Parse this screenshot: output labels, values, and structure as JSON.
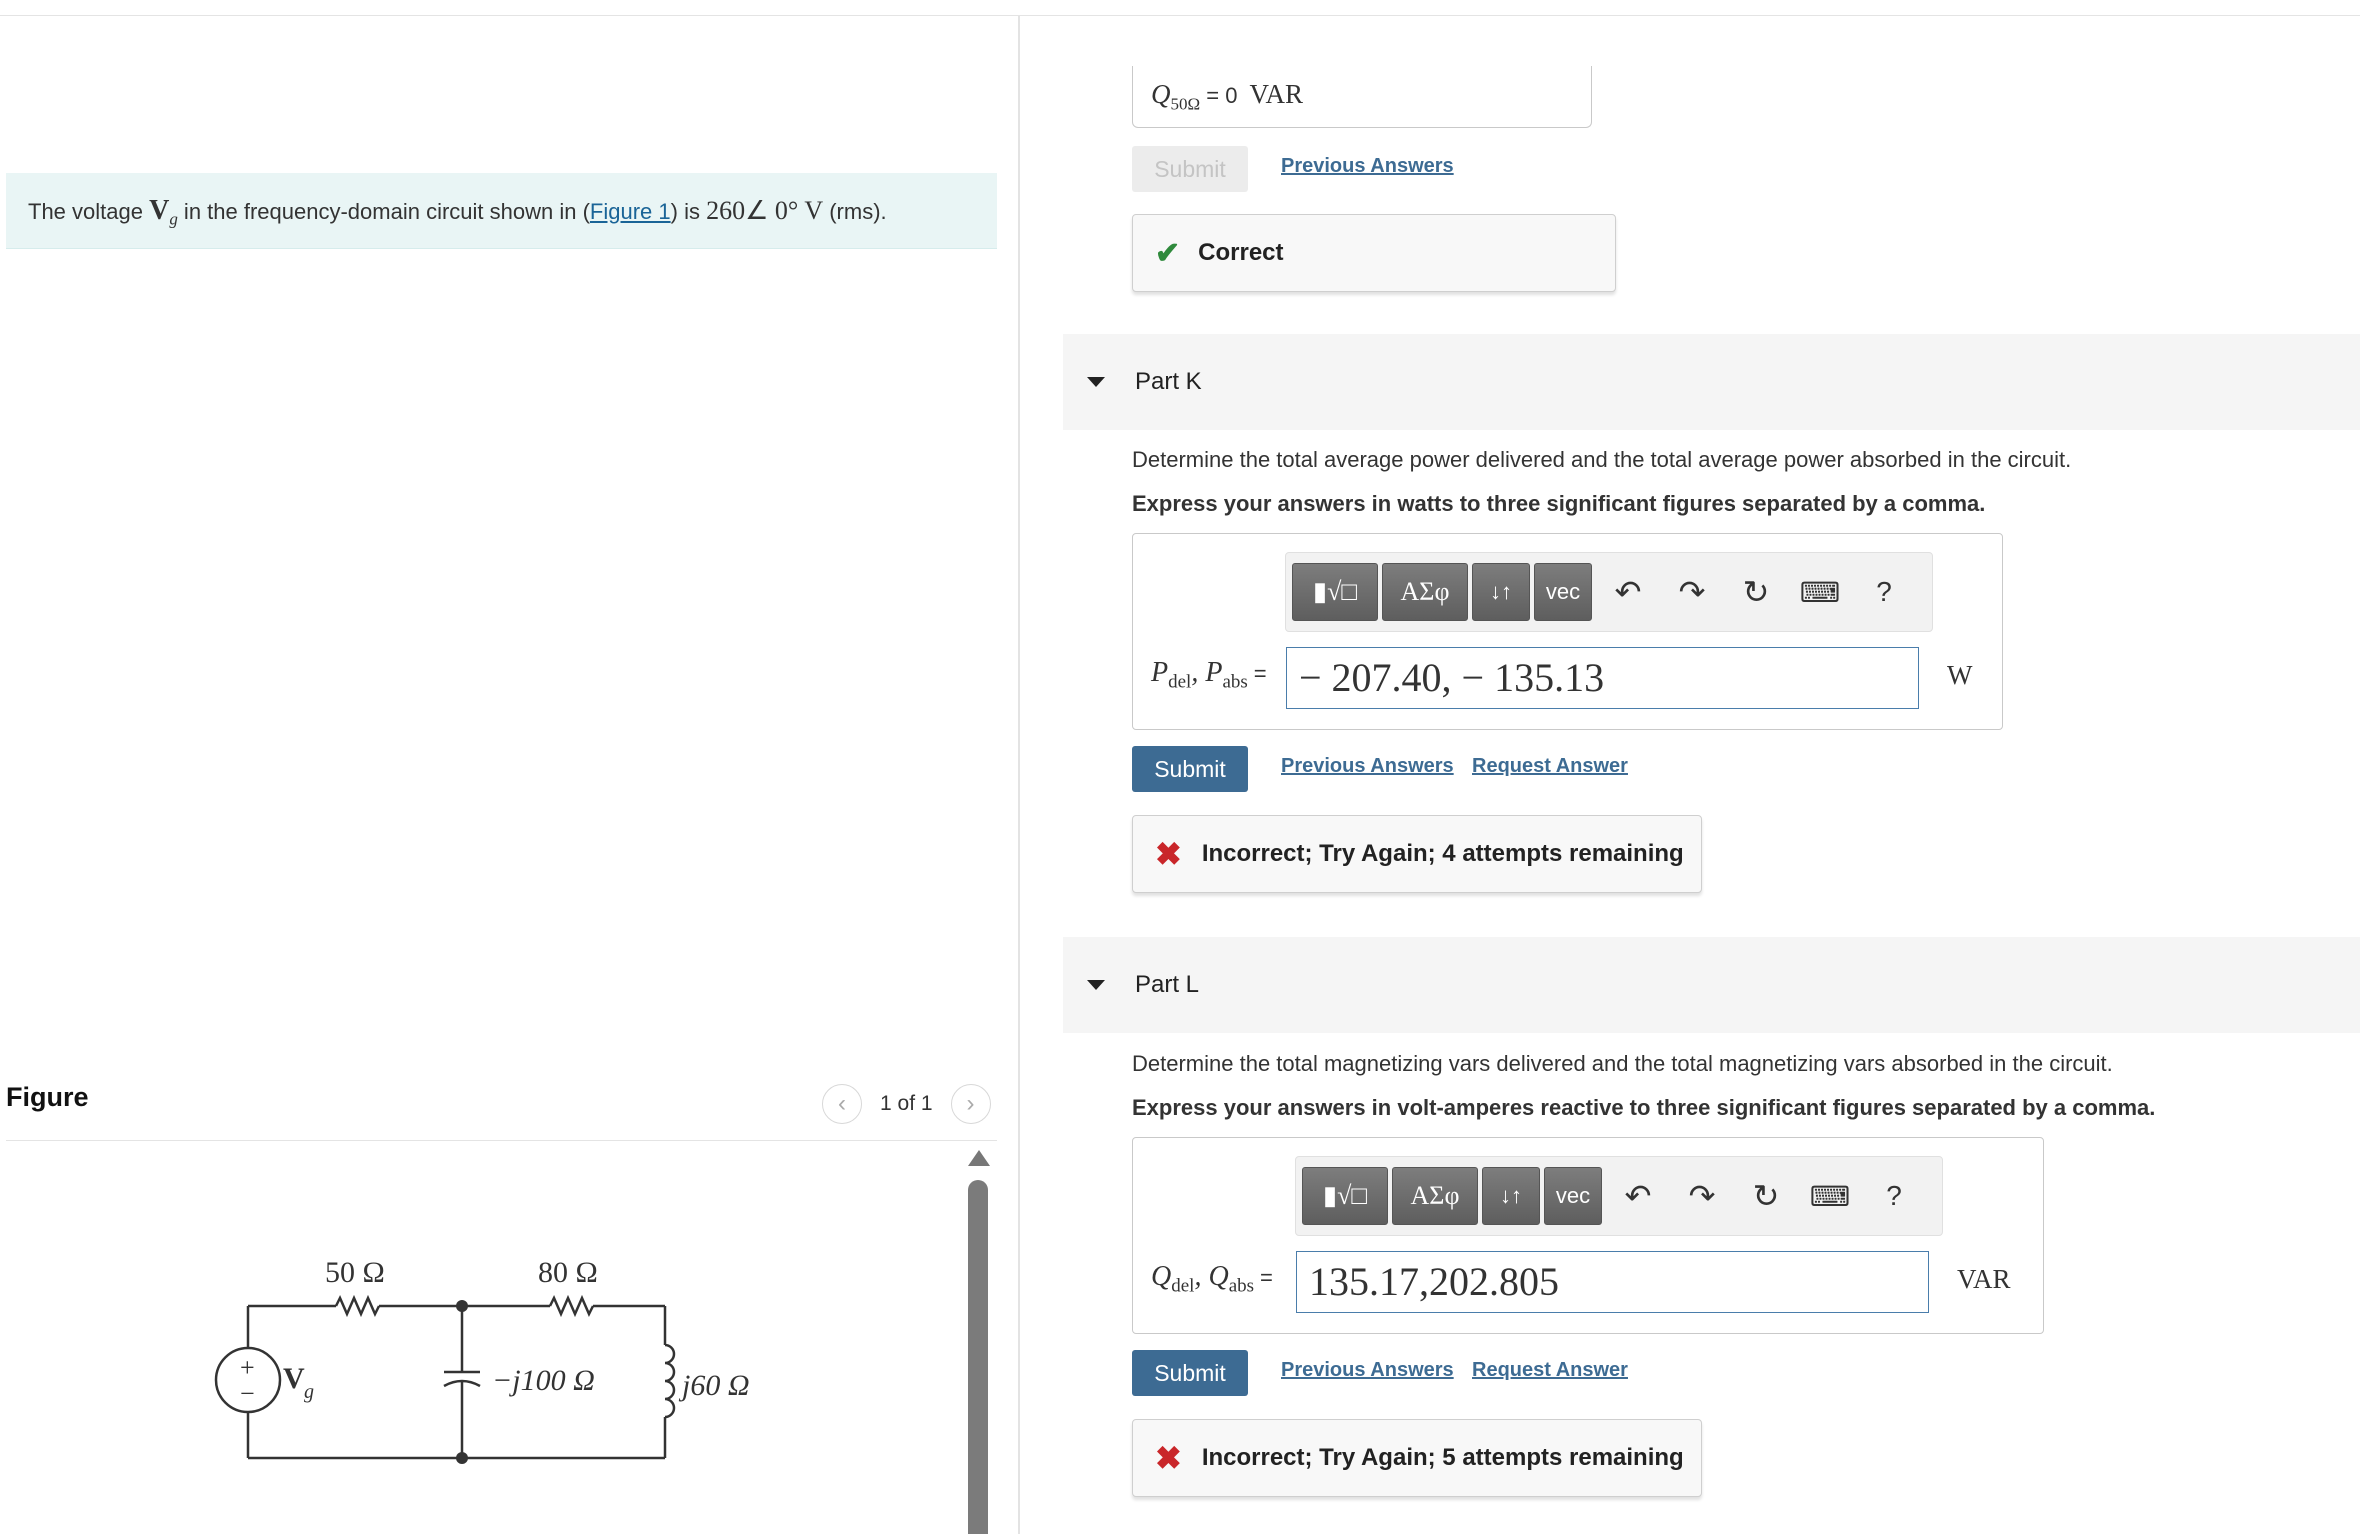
{
  "intro": {
    "pre": "The voltage ",
    "var_main": "V",
    "var_sub": "g",
    "mid": " in the frequency-domain circuit shown in (",
    "figure_link": "Figure 1",
    "post": ") is ",
    "value": "260∠ 0°",
    "unit": " V",
    "tail": " (rms)."
  },
  "figure": {
    "title": "Figure",
    "pager_text": "1 of 1",
    "circuit_labels": {
      "r1": "50 Ω",
      "r2": "80 Ω",
      "cap": "−j100 Ω",
      "ind": "j60 Ω",
      "source_main": "V",
      "source_sub": "g",
      "plus": "+",
      "minus": "−"
    }
  },
  "previous_part": {
    "label_main": "Q",
    "label_sub": "50Ω",
    "equals": " = ",
    "value": "0",
    "unit": "VAR",
    "submit_label": "Submit",
    "previous_answers_label": "Previous Answers",
    "feedback": "Correct"
  },
  "parts": [
    {
      "title": "Part K",
      "question": "Determine the total average power delivered and the total average power absorbed in the circuit.",
      "instruction": "Express your answers in watts to three significant figures separated by a comma.",
      "label_a": "P",
      "label_a_sub": "del",
      "label_b": "P",
      "label_b_sub": "abs",
      "equals": "=",
      "input_value": "− 207.40, − 135.13",
      "unit": "W",
      "submit_label": "Submit",
      "previous_answers_label": "Previous Answers",
      "request_answer_label": "Request Answer",
      "feedback": "Incorrect; Try Again; 4 attempts remaining"
    },
    {
      "title": "Part L",
      "question": "Determine the total magnetizing vars delivered and the total magnetizing vars absorbed in the circuit.",
      "instruction": "Express your answers in volt-amperes reactive to three significant figures separated by a comma.",
      "label_a": "Q",
      "label_a_sub": "del",
      "label_b": "Q",
      "label_b_sub": "abs",
      "equals": "=",
      "input_value": "135.17,202.805",
      "unit": "VAR",
      "submit_label": "Submit",
      "previous_answers_label": "Previous Answers",
      "request_answer_label": "Request Answer",
      "feedback": "Incorrect; Try Again; 5 attempts remaining"
    }
  ],
  "toolbar": {
    "templates_label": "▮√□",
    "greek_label": "ΑΣφ",
    "arrows_label": "↓↑",
    "vec_label": "vec",
    "help_label": "?",
    "icons": [
      "templates-icon",
      "greek-icon",
      "arrows-icon",
      "vec-icon",
      "undo-icon",
      "redo-icon",
      "reset-icon",
      "keyboard-icon",
      "help-icon"
    ]
  },
  "colors": {
    "primary_button": "#3d6b93",
    "link": "#3d6b93",
    "correct": "#2f8a3c",
    "incorrect": "#c9262a",
    "intro_bg": "#e9f5f5"
  }
}
